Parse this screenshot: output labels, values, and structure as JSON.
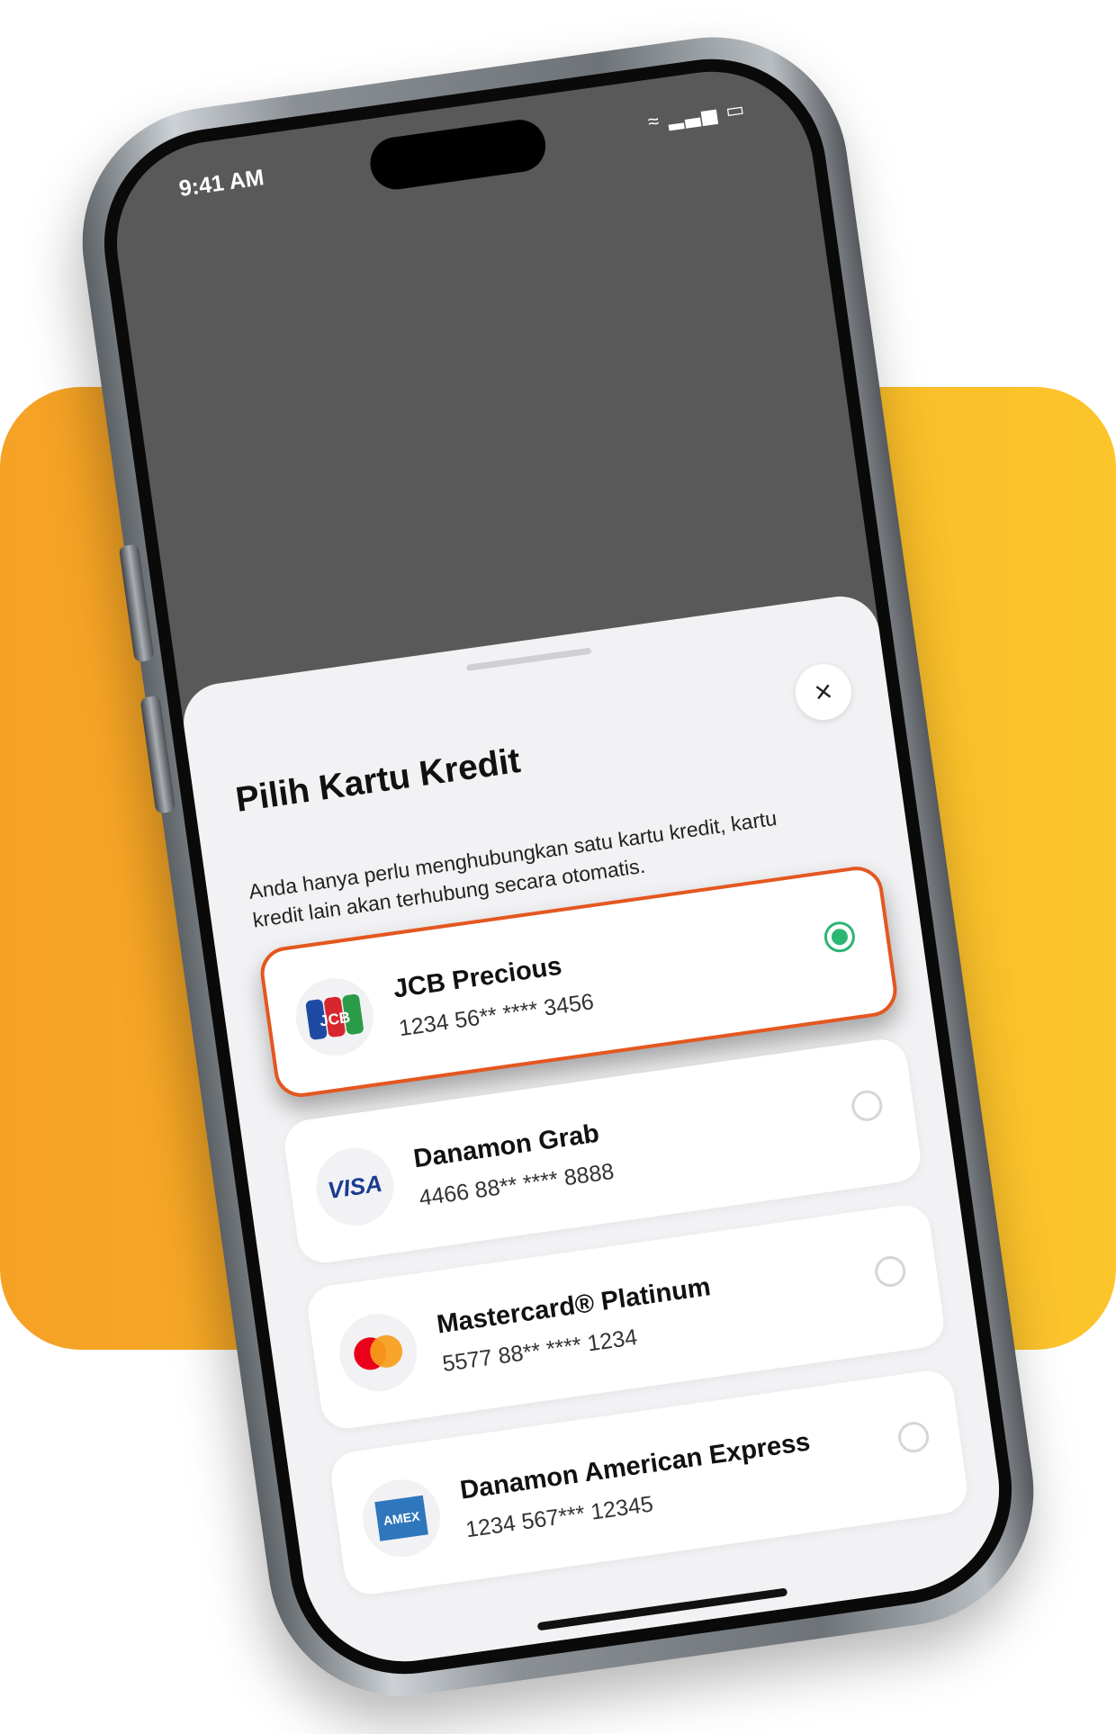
{
  "theme": {
    "accent_selected_border": "#e4571f",
    "radio_selected": "#2bb673",
    "background_shape": "#f8b427"
  },
  "status_bar": {
    "time": "9:41 AM",
    "icons": [
      "wifi-icon",
      "cellular-signal-icon",
      "battery-icon"
    ]
  },
  "sheet": {
    "title": "Pilih Kartu Kredit",
    "subtitle": "Anda hanya perlu menghubungkan satu kartu kredit, kartu kredit lain akan terhubung secara otomatis.",
    "close_icon": "close-icon"
  },
  "cards": [
    {
      "name": "JCB Precious",
      "number": "1234 56** **** 3456",
      "brand": "jcb",
      "brand_label": "JCB",
      "selected": true
    },
    {
      "name": "Danamon Grab",
      "number": "4466 88** **** 8888",
      "brand": "visa",
      "brand_label": "VISA",
      "selected": false
    },
    {
      "name": "Mastercard® Platinum",
      "number": "5577 88** **** 1234",
      "brand": "mastercard",
      "selected": false
    },
    {
      "name": "Danamon American Express",
      "number": "1234 567*** 12345",
      "brand": "amex",
      "brand_label": "AMEX",
      "selected": false
    }
  ]
}
